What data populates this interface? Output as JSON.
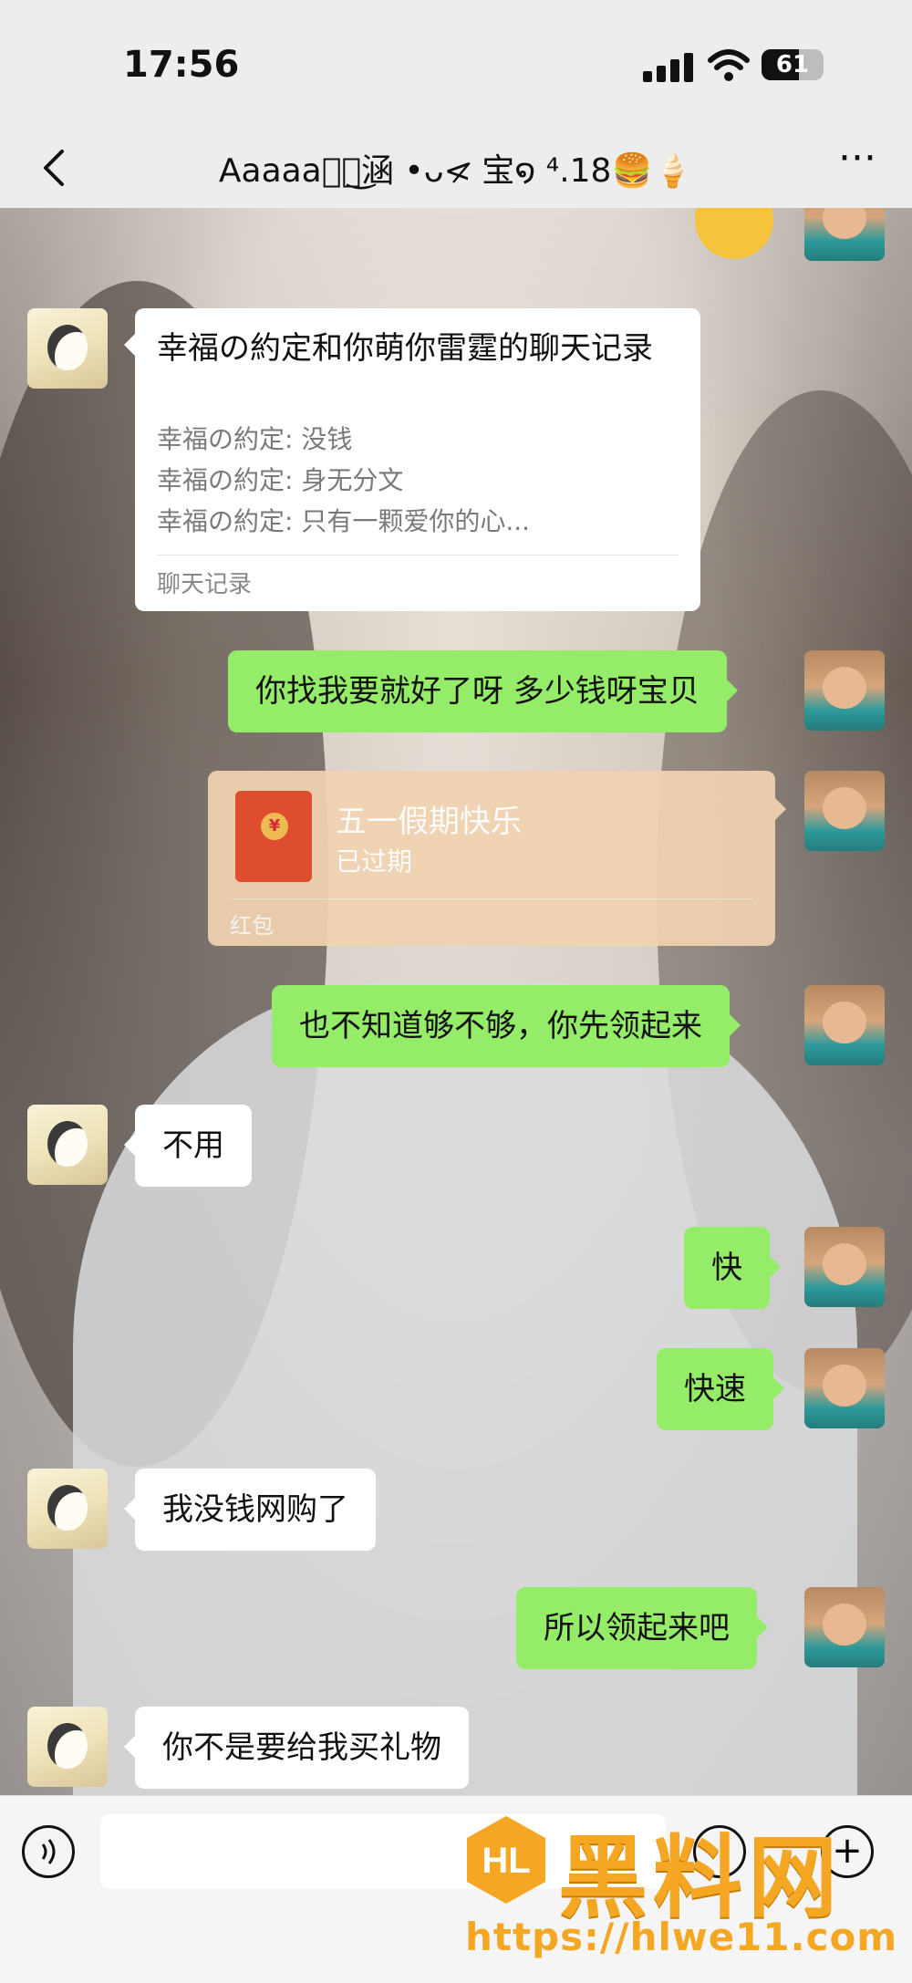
{
  "status": {
    "time": "17:56",
    "battery": "61"
  },
  "header": {
    "title": "Aaaaaศ๊͜涵 •ᴗ<̷̷ 宝໑ ⁴.18🍔🍦"
  },
  "chat_record": {
    "title": "幸福の約定和你萌你雷霆的聊天记录",
    "lines": [
      "幸福の約定: 没钱",
      "幸福の約定: 身无分文",
      "幸福の約定: 只有一颗爱你的心..."
    ],
    "footer": "聊天记录"
  },
  "messages": {
    "m1": "你找我要就好了呀 多少钱呀宝贝",
    "m3": "也不知道够不够，你先领起来",
    "m4": "不用",
    "m5": "快",
    "m6": "快速",
    "m7": "我没钱网购了",
    "m8": "所以领起来吧",
    "m9": "你不是要给我买礼物"
  },
  "red_packet": {
    "title": "五一假期快乐",
    "status": "已过期",
    "label": "红包"
  },
  "watermark": {
    "text": "黑料网",
    "url": "https://hlwe11.com"
  },
  "icons": [
    "back-icon",
    "more-icon",
    "signal-icon",
    "wifi-icon",
    "battery-icon",
    "voice-icon",
    "emoji-icon",
    "plus-icon"
  ]
}
